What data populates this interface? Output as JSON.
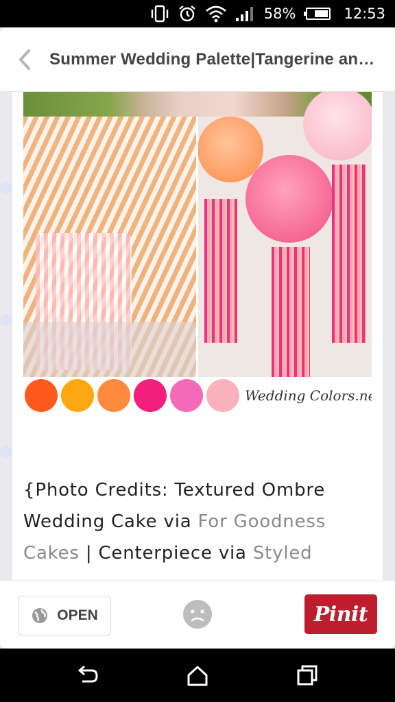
{
  "status_bar": {
    "battery_percent": "58%",
    "time": "12:53",
    "icons": [
      "vibrate-icon",
      "alarm-icon",
      "wifi-icon",
      "signal-icon",
      "battery-icon"
    ]
  },
  "header": {
    "back_icon": "chevron-left-icon",
    "title": "Summer Wedding Palette|Tangerine and..."
  },
  "pin": {
    "brand_text": "Wedding Colors.net",
    "swatches": [
      "#ff5a1e",
      "#ffa712",
      "#ff8a3d",
      "#f2207a",
      "#f46ab9",
      "#f9b1bb"
    ]
  },
  "description": {
    "parts": [
      {
        "text": "{Photo Credits: Textured Ombre Wedding Cake via ",
        "link": false
      },
      {
        "text": "For Goodness Cakes",
        "link": true
      },
      {
        "text": " | Centerpiece via ",
        "link": false
      },
      {
        "text": "Styled",
        "link": true
      }
    ]
  },
  "actions": {
    "open_label": "OPEN",
    "pin_it_label": "Pinit"
  },
  "nav": {
    "icons": [
      "back-icon",
      "home-icon",
      "recents-icon"
    ]
  },
  "colors": {
    "pin_red": "#bd1e2d",
    "link_gray": "#8a8a8a"
  }
}
